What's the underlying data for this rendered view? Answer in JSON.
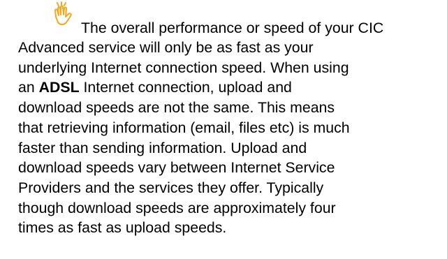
{
  "icon": {
    "name": "raised-hand-icon",
    "stroke_color": "#f0a81c"
  },
  "paragraph": {
    "lines": [
      "The overall performance or speed of your CIC",
      "Advanced service will only be as fast as your",
      "underlying Internet connection speed. When using",
      "an ",
      "ADSL",
      " Internet connection, upload and",
      "download speeds are not the same. This means",
      "that retrieving information (email, files etc) is much",
      "faster than sending information. Upload and",
      "download speeds vary between Internet Service",
      "Providers and the services they offer. Typically",
      "though download speeds are approximately four",
      "times as fast as upload speeds."
    ]
  }
}
